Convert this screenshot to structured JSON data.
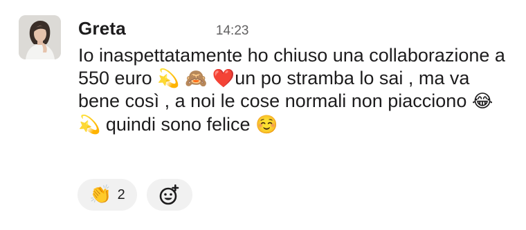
{
  "message": {
    "author": "Greta",
    "timestamp": "14:23",
    "text_segments": [
      "Io inaspettatamente ho chiuso una collaborazione a 550 euro ",
      "💫",
      " ",
      "🙈",
      " ",
      "❤️",
      "un po stramba lo sai , ma va bene così , a noi le cose normali non piacciono ",
      "😂",
      "💫",
      " quindi sono felice ",
      "☺️"
    ]
  },
  "reactions": [
    {
      "icon": "clapping-hands-icon",
      "emoji": "👏",
      "count": "2"
    }
  ],
  "add_reaction": {
    "icon": "add-emoji-icon"
  },
  "colors": {
    "text": "#1d1c1d",
    "timestamp": "#616061",
    "pill_background": "#f1f1f1"
  }
}
